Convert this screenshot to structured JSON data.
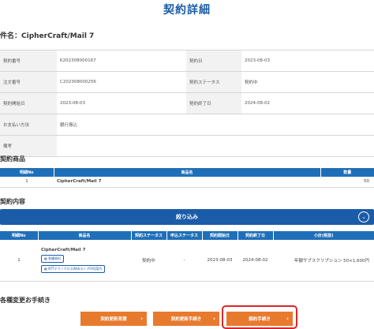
{
  "page": {
    "title": "契約詳細",
    "subject_prefix": "件名：",
    "subject": "CipherCraft/Mail 7"
  },
  "info": {
    "rows": [
      {
        "l1": "契約番号",
        "v1": "K202308000167",
        "l2": "契約日",
        "v2": "2023-08-03"
      },
      {
        "l1": "注文番号",
        "v1": "C202308000256",
        "l2": "契約ステータス",
        "v2": "契約中"
      },
      {
        "l1": "契約開始日",
        "v1": "2023-08-03",
        "l2": "契約終了日",
        "v2": "2024-08-02"
      },
      {
        "l1": "お支払い方法",
        "v1": "銀行振込"
      },
      {
        "l1": "備考",
        "v1": ""
      }
    ]
  },
  "products": {
    "heading": "契約商品",
    "headers": [
      "明細No",
      "商品名",
      "数量"
    ],
    "rows": [
      {
        "no": "1",
        "name": "CipherCraft/Mail 7",
        "qty": "50"
      }
    ]
  },
  "contents": {
    "heading": "契約内容",
    "filter_label": "絞り込み",
    "filter_icon": "chevron-down",
    "headers": [
      "明細No",
      "商品名",
      "契約ステータス",
      "申込ステータス",
      "契約開始日",
      "契約終了日",
      "小計(税抜)"
    ],
    "rows": [
      {
        "no": "1",
        "name": "CipherCraft/Mail 7",
        "btn1": "各種資料",
        "btn2": "NTTテクノクロスWebストアFAQ案内",
        "status": "契約中",
        "apply_status": "-",
        "start": "2023-08-03",
        "end": "2024-08-02",
        "subtotal": "年額サブスクリプション 50×1,600円"
      }
    ]
  },
  "procedures": {
    "heading": "各種変更お手続き",
    "buttons": [
      "契約更新見積",
      "契約更新手続き",
      "解約手続き"
    ],
    "accent": "#e87a2e",
    "highlight_color": "#d9262c"
  }
}
